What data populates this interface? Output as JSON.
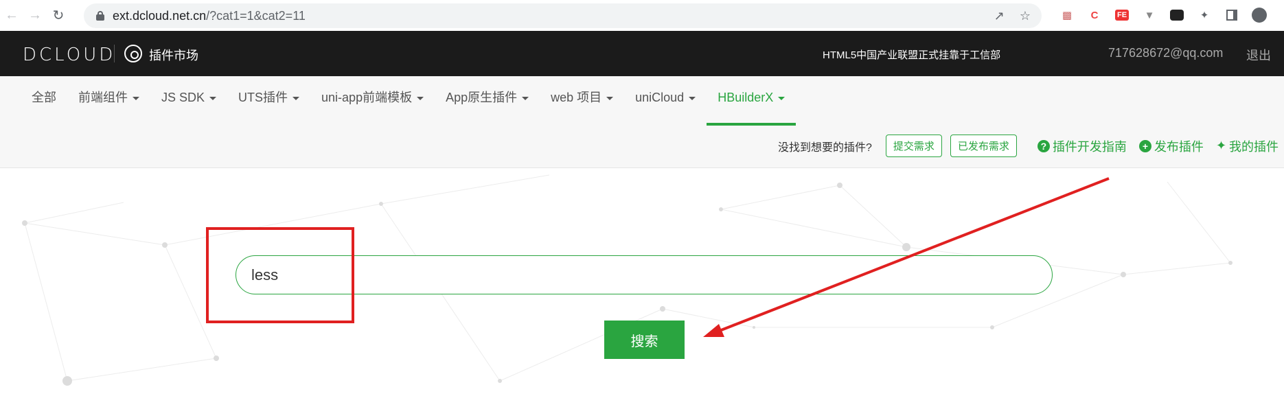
{
  "browser": {
    "url_host": "ext.dcloud.net.cn",
    "url_path": "/?cat1=1&cat2=11"
  },
  "header": {
    "logo": "DCLOUD",
    "market": "插件市场",
    "notice": "HTML5中国产业联盟正式挂靠于工信部",
    "user": "717628672@qq.com",
    "logout": "退出"
  },
  "nav": {
    "tabs": [
      {
        "label": "全部"
      },
      {
        "label": "前端组件"
      },
      {
        "label": "JS SDK"
      },
      {
        "label": "UTS插件"
      },
      {
        "label": "uni-app前端模板"
      },
      {
        "label": "App原生插件"
      },
      {
        "label": "web 项目"
      },
      {
        "label": "uniCloud"
      },
      {
        "label": "HBuilderX"
      }
    ],
    "active": "HBuilderX",
    "question": "没找到想要的插件?",
    "submit": "提交需求",
    "published": "已发布需求",
    "guide": "插件开发指南",
    "publish": "发布插件",
    "mine": "我的插件"
  },
  "search": {
    "value": "less",
    "button": "搜索"
  },
  "colors": {
    "accent": "#2aa540",
    "header_bg": "#1b1b1b",
    "annotation": "#e02020"
  }
}
